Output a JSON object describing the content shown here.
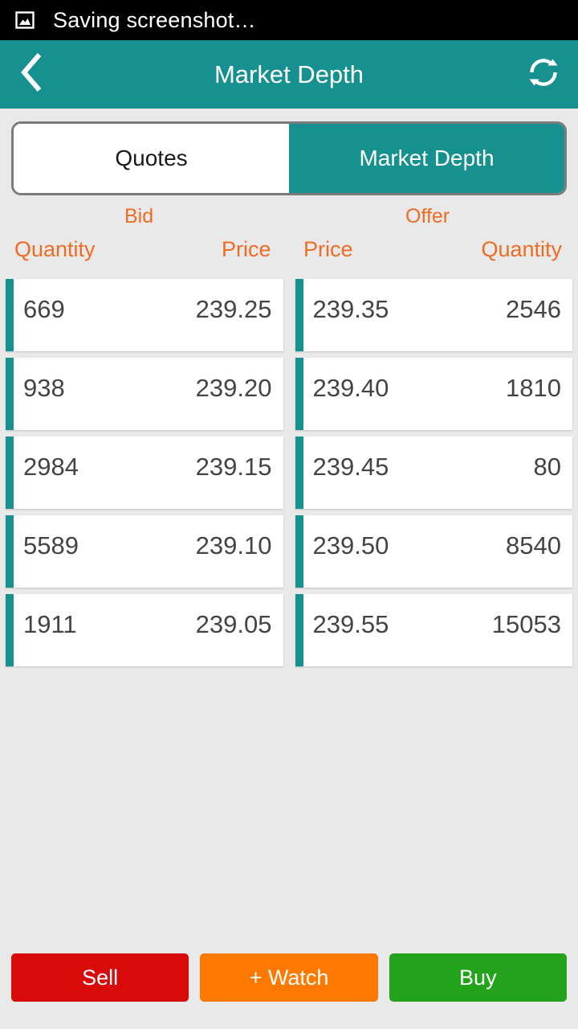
{
  "status_bar": {
    "icon": "image-icon",
    "message": "Saving screenshot…"
  },
  "app_bar": {
    "back_icon": "chevron-left-icon",
    "title": "Market Depth",
    "refresh_icon": "refresh-icon"
  },
  "tabs": [
    {
      "label": "Quotes",
      "active": false
    },
    {
      "label": "Market Depth",
      "active": true
    }
  ],
  "headers": {
    "bid_side": "Bid",
    "offer_side": "Offer",
    "bid_quantity": "Quantity",
    "bid_price": "Price",
    "offer_price": "Price",
    "offer_quantity": "Quantity"
  },
  "book": {
    "bids": [
      {
        "quantity": "669",
        "price": "239.25"
      },
      {
        "quantity": "938",
        "price": "239.20"
      },
      {
        "quantity": "2984",
        "price": "239.15"
      },
      {
        "quantity": "5589",
        "price": "239.10"
      },
      {
        "quantity": "1911",
        "price": "239.05"
      }
    ],
    "offers": [
      {
        "price": "239.35",
        "quantity": "2546"
      },
      {
        "price": "239.40",
        "quantity": "1810"
      },
      {
        "price": "239.45",
        "quantity": "80"
      },
      {
        "price": "239.50",
        "quantity": "8540"
      },
      {
        "price": "239.55",
        "quantity": "15053"
      }
    ]
  },
  "actions": [
    {
      "label": "Sell",
      "color": "#d80a0a"
    },
    {
      "label": "+ Watch",
      "color": "#ff7800"
    },
    {
      "label": "Buy",
      "color": "#22a31b"
    }
  ],
  "colors": {
    "accent_teal": "#17918f",
    "header_orange": "#ef6c24",
    "page_background": "#e9e9e9",
    "status_bar": "#000000"
  }
}
